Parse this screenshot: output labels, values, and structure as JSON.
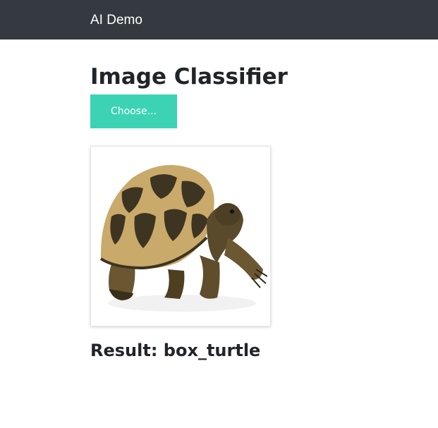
{
  "navbar": {
    "brand": "AI Demo"
  },
  "page": {
    "title": "Image Classifier",
    "choose_label": "Choose...",
    "result_prefix": "Result:",
    "result_value": "box_turtle"
  },
  "image": {
    "icon": "turtle-photo"
  },
  "colors": {
    "navbar_bg": "#343a40",
    "button_bg": "#3bd3b4",
    "text": "#212529"
  }
}
